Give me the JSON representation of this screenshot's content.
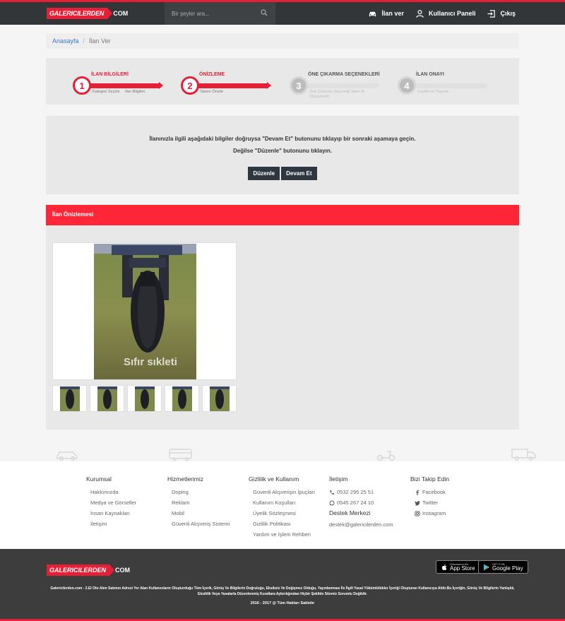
{
  "header": {
    "logo_main": "GALERICILERDEN",
    "logo_suffix": "COM",
    "search_placeholder": "Bir şeyler ara...",
    "nav": [
      {
        "label": "İlan ver",
        "icon": "car-icon"
      },
      {
        "label": "Kullanıcı Paneli",
        "icon": "user-icon"
      },
      {
        "label": "Çıkış",
        "icon": "logout-icon"
      }
    ]
  },
  "breadcrumb": {
    "home": "Anasayfa",
    "separator": "/",
    "current": "İlan Ver"
  },
  "steps": [
    {
      "number": "1",
      "title": "İLAN BİLGİLERİ",
      "sub": "Kategori Seçimi     İlan Bilgileri",
      "state": "active"
    },
    {
      "number": "2",
      "title": "ÖNİZLEME",
      "sub": "İlanını Önizle",
      "state": "active"
    },
    {
      "number": "3",
      "title": "ÖNE ÇIKARMA SEÇENEKLERİ",
      "sub": "Öne Çıkarma Seçeneği Satın Al\n(Opsiyonel)",
      "state": "dim"
    },
    {
      "number": "4",
      "title": "İLAN ONAYI",
      "sub": "Kaydet ve Yayınla",
      "state": "dim"
    }
  ],
  "info": {
    "line1": "İlanınızla ilgili aşağıdaki bilgiler doğruysa \"Devam Et\" butonunu tıklayıp bir sonraki aşamaya geçin.",
    "line2": "Değilse \"Düzenle\" butonunu tıklayın.",
    "edit_label": "Düzenle",
    "continue_label": "Devam Et"
  },
  "preview": {
    "title": "İlan Önizlemesi",
    "watermark": "Sıfır sıkleti",
    "thumb_count": 5
  },
  "footer": {
    "columns": [
      {
        "title": "Kurumsal",
        "items": [
          "Hakkımızda",
          "Medya ve Görseller",
          "İnsan Kaynakları",
          "İletişim"
        ]
      },
      {
        "title": "Hizmetlerimiz",
        "items": [
          "Doping",
          "Reklam",
          "Mobil",
          "Güvenli Alışveriş Sistemi"
        ]
      },
      {
        "title": "Gizlilik ve Kullanım",
        "items": [
          "Güvenli Alışverişin İpuçları",
          "Kullanım Koşulları",
          "Üyelik Sözleşmesi",
          "Gizlilik Politikası",
          "Yardım ve İşlem Rehberi"
        ]
      }
    ],
    "contact": {
      "title": "İletişim",
      "phone1": "0532 295 25 51",
      "phone2": "0545 267 24 10",
      "support_title": "Destek Merkezi",
      "email": "destek@galericilerden.com"
    },
    "social": {
      "title": "Bizi Takip Edin",
      "items": [
        "Facebook",
        "Twitter",
        "Instagram"
      ]
    }
  },
  "bottom": {
    "appstore_small": "Download on the",
    "appstore_big": "App Store",
    "googleplay_small": "GET IT ON",
    "googleplay_big": "Google Play",
    "legal": "Galericilerden.com - 2.El Oto Alım Satımın Adresi Yer Alan Kullanıcıların Oluşturduğu Tüm İçerik, Görüş Ve Bilgilerin Doğruluğu, Eksiksiz Ve Değişmez Olduğu, Yayınlanması İle İlgili Yasal Yükümlülükler İçeriği Oluşturan Kullanıcıya Aittir.Bu İçeriğin, Görüş Ve Bilgilerin Yanlışlık, Eksiklik Veya Yasalarla Düzenlenmiş Kurallara Aykırılığından Hiçbir Şekilde Sitemiz Sorumlu Değildir.",
    "copyright": "2016 - 2017 @ Tüm Hakları Saklıdır"
  },
  "colors": {
    "brand_red": "#e51f36",
    "header_dark": "#333638",
    "button_dark": "#2e3640"
  }
}
